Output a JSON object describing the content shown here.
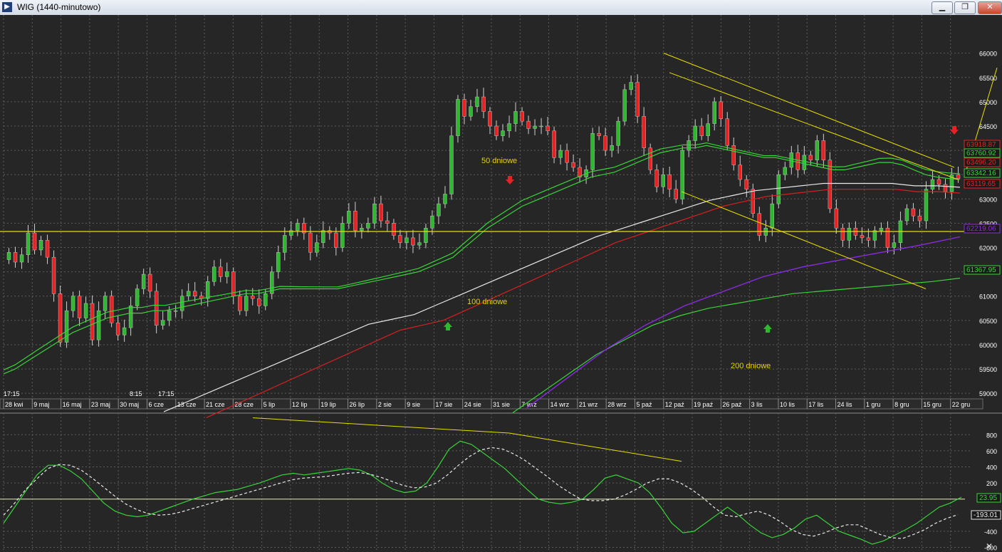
{
  "window": {
    "title": "WIG (1440-minutowo)",
    "minimize_icon": "minimize-icon",
    "maximize_icon": "restore-icon",
    "close_icon": "close-icon",
    "min_label": "▁",
    "max_label": "❐",
    "close_label": "✕",
    "panel_close_label": "✕"
  },
  "colors": {
    "background": "#262626",
    "grid": "#5c5c5c",
    "axis_text": "#ffffff",
    "up_candle": "#2fb82f",
    "down_candle": "#e82222",
    "ma_green": "#38d438",
    "ma_white": "#e8e8e8",
    "ma_red": "#d62020",
    "ma_purple": "#8a2be2",
    "trendline": "#e8e000",
    "annotation_text": "#e8d000"
  },
  "chart_data": [
    {
      "type": "candlestick",
      "ylim": [
        58900,
        66200
      ],
      "yticks": [
        59000,
        59500,
        60000,
        60500,
        61000,
        61500,
        62000,
        62500,
        63000,
        63500,
        64000,
        64500,
        65000,
        65500,
        66000
      ],
      "ytick_labels": [
        "59000",
        "59500",
        "60000",
        "60500",
        "61000",
        "61500",
        "62000",
        "62500",
        "63000",
        "63500",
        "64000",
        "64500",
        "65000",
        "65500",
        "66000"
      ],
      "xtick_labels": [
        "28 kwi",
        "9 maj",
        "16 maj",
        "23 maj",
        "30 maj",
        "6 cze",
        "13 cze",
        "21 cze",
        "28 cze",
        "5 lip",
        "12 lip",
        "19 lip",
        "26 lip",
        "2 sie",
        "9 sie",
        "17 sie",
        "24 sie",
        "31 sie",
        "7 wrz",
        "14 wrz",
        "21 wrz",
        "28 wrz",
        "5 paź",
        "12 paź",
        "19 paź",
        "26 paź",
        "3 lis",
        "10 lis",
        "17 lis",
        "24 lis",
        "1 gru",
        "8 gru",
        "15 gru",
        "22 gru"
      ],
      "time_labels": [
        "17:15",
        "8:15",
        "17:15"
      ],
      "close": [
        61900,
        61700,
        61850,
        62300,
        61950,
        62150,
        61800,
        61050,
        60050,
        60700,
        61000,
        60550,
        60850,
        60100,
        60700,
        61000,
        60450,
        60200,
        60350,
        60800,
        61150,
        61450,
        61100,
        60400,
        60500,
        60700,
        60700,
        61000,
        61100,
        61000,
        60950,
        61300,
        61600,
        61400,
        61500,
        61000,
        60700,
        61000,
        60950,
        60800,
        61050,
        61500,
        61900,
        62250,
        62350,
        62500,
        62300,
        61900,
        62100,
        62350,
        62300,
        62000,
        62500,
        62750,
        62350,
        62400,
        62500,
        62900,
        62550,
        62500,
        62250,
        62100,
        62200,
        62050,
        62100,
        62400,
        62650,
        62900,
        63100,
        64300,
        65050,
        64700,
        64900,
        65100,
        64800,
        64500,
        64300,
        64400,
        64550,
        64800,
        64600,
        64450,
        64500,
        64500,
        64400,
        63850,
        64000,
        63750,
        63650,
        63450,
        63600,
        64350,
        64300,
        64000,
        64100,
        64600,
        65250,
        65400,
        64700,
        64050,
        63600,
        63250,
        63500,
        63200,
        63000,
        64000,
        64200,
        64500,
        64300,
        64550,
        65000,
        64650,
        64100,
        63700,
        63400,
        63200,
        62700,
        62250,
        62400,
        62900,
        63500,
        63650,
        63950,
        63600,
        63900,
        63800,
        64200,
        63800,
        62800,
        62400,
        62150,
        62400,
        62250,
        62200,
        62150,
        62350,
        62400,
        62000,
        62100,
        62550,
        62800,
        62650,
        62550,
        63200,
        63400,
        63300,
        63150,
        63500,
        63420
      ],
      "series": [
        {
          "name": "50 dniowe",
          "values": [
            59400,
            59500,
            59650,
            59800,
            59950,
            60100,
            60250,
            60350,
            60450,
            60550,
            60600,
            60650,
            60650,
            60700,
            60700,
            60750,
            60800,
            60850,
            60900,
            60950,
            61000,
            61050,
            61050,
            61100,
            61150,
            61150,
            61150,
            61150,
            61150,
            61150,
            61200,
            61250,
            61300,
            61350,
            61400,
            61450,
            61500,
            61600,
            61700,
            61800,
            62000,
            62200,
            62400,
            62550,
            62700,
            62850,
            62950,
            63050,
            63150,
            63250,
            63350,
            63450,
            63500,
            63550,
            63650,
            63750,
            63850,
            63950,
            64000,
            64050,
            64050,
            64100,
            64050,
            64000,
            63950,
            63900,
            63850,
            63850,
            63800,
            63750,
            63700,
            63650,
            63600,
            63600,
            63650,
            63700,
            63750,
            63750,
            63700,
            63600,
            63500,
            63450,
            63420,
            63400
          ]
        },
        {
          "name": "100 dniowe",
          "values": [
            58500,
            58700,
            58900,
            59100,
            59300,
            59500,
            59700,
            59900,
            60100,
            60300,
            60400,
            60500,
            60700,
            60900,
            61100,
            61300,
            61500,
            61700,
            61900,
            62100,
            62250,
            62400,
            62550,
            62700,
            62850,
            62950,
            63050,
            63100,
            63150,
            63200,
            63200,
            63200,
            63200,
            63150,
            63150,
            63120
          ]
        },
        {
          "name": "200 dniowe",
          "values": [
            58600,
            59000,
            59400,
            59800,
            60100,
            60400,
            60600,
            60750,
            60850,
            60950,
            61050,
            61100,
            61150,
            61200,
            61250,
            61300,
            61370
          ]
        }
      ],
      "last_values": [
        {
          "label": "63918.87",
          "color": "#e82222",
          "border": "#e82222"
        },
        {
          "label": "63760.92",
          "color": "#38d438",
          "border": "#38d438"
        },
        {
          "label": "63496.20",
          "color": "#e82222",
          "border": "#e82222"
        },
        {
          "label": "63342.16",
          "color": "#38d438",
          "border": "#38d438"
        },
        {
          "label": "63119.65",
          "color": "#e82222",
          "border": "#e82222"
        },
        {
          "label": "62219.06",
          "color": "#8a2be2",
          "border": "#8a2be2"
        },
        {
          "label": "61367.95",
          "color": "#38d438",
          "border": "#38d438"
        }
      ],
      "annotations": [
        {
          "text": "50 dniowe"
        },
        {
          "text": "100 dniowe"
        },
        {
          "text": "200 dniowe"
        }
      ],
      "arrows": [
        {
          "direction": "down",
          "color": "#e82222"
        },
        {
          "direction": "down",
          "color": "#e82222"
        },
        {
          "direction": "up",
          "color": "#2fb82f"
        },
        {
          "direction": "up",
          "color": "#2fb82f"
        }
      ],
      "grid": true
    },
    {
      "type": "line",
      "ylim": [
        -640,
        900
      ],
      "yticks": [
        800,
        600,
        400,
        200,
        -400,
        -600
      ],
      "ytick_labels": [
        "800",
        "600",
        "400",
        "200",
        "-400",
        "-600"
      ],
      "zero_line": 0,
      "series": [
        {
          "values": [
            -300,
            -100,
            100,
            300,
            420,
            420,
            350,
            250,
            100,
            -50,
            -150,
            -200,
            -220,
            -200,
            -150,
            -100,
            -50,
            0,
            40,
            80,
            100,
            120,
            160,
            200,
            250,
            300,
            320,
            300,
            320,
            340,
            360,
            380,
            360,
            300,
            200,
            120,
            80,
            100,
            200,
            400,
            620,
            720,
            680,
            580,
            480,
            380,
            250,
            120,
            0,
            -40,
            -60,
            -40,
            0,
            120,
            260,
            300,
            250,
            200,
            80,
            -100,
            -300,
            -420,
            -400,
            -300,
            -200,
            -100,
            -200,
            -320,
            -420,
            -480,
            -440,
            -360,
            -250,
            -200,
            -300,
            -400,
            -450,
            -500,
            -560,
            -520,
            -450,
            -380,
            -300,
            -200,
            -100,
            -50,
            24
          ]
        },
        {
          "values": [
            -200,
            -50,
            120,
            250,
            380,
            430,
            420,
            360,
            260,
            150,
            40,
            -60,
            -130,
            -180,
            -200,
            -190,
            -160,
            -120,
            -80,
            -40,
            0,
            40,
            80,
            120,
            160,
            200,
            240,
            260,
            270,
            280,
            300,
            320,
            330,
            310,
            270,
            220,
            170,
            140,
            150,
            200,
            300,
            420,
            530,
            610,
            640,
            620,
            560,
            480,
            380,
            280,
            170,
            80,
            0,
            -20,
            -20,
            0,
            50,
            120,
            200,
            250,
            250,
            200,
            120,
            20,
            -100,
            -200,
            -220,
            -180,
            -150,
            -200,
            -280,
            -380,
            -440,
            -460,
            -420,
            -360,
            -320,
            -320,
            -380,
            -440,
            -480,
            -490,
            -440,
            -380,
            -300,
            -240,
            -193
          ]
        }
      ],
      "last_values": [
        {
          "label": "23.95",
          "color": "#38d438",
          "border": "#38d438"
        },
        {
          "label": "-193.01",
          "color": "#e8e8e8",
          "border": "#e8e8e8"
        }
      ],
      "grid": true
    }
  ]
}
